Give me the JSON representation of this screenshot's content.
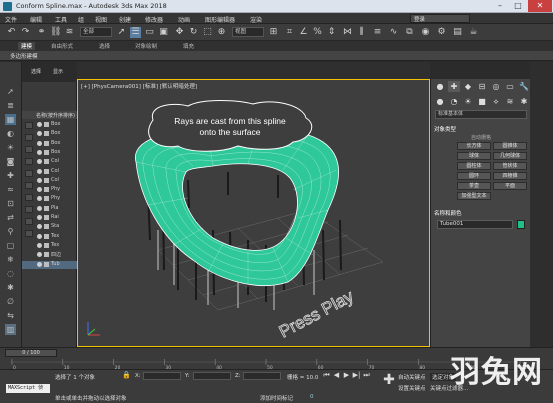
{
  "window": {
    "title": "Conform Spline.max - Autodesk 3ds Max 2018"
  },
  "menu": {
    "items": [
      "文件",
      "编辑",
      "工具",
      "组",
      "视图",
      "创建",
      "修改器",
      "动画",
      "图形编辑器",
      "渲染"
    ],
    "login": "登录"
  },
  "toolbar": {
    "filter": "全部",
    "view": "视图"
  },
  "ribbon": {
    "tabs": [
      "建模",
      "自由形式",
      "选择",
      "对象绘制",
      "填充"
    ],
    "sub": "多边形建模"
  },
  "explorer": {
    "tabs": [
      "选择",
      "显示"
    ],
    "header": "名称(按升序排序)",
    "rows": [
      "Box",
      "Box",
      "Box",
      "Box",
      "Col",
      "Col",
      "Col",
      "Phy",
      "Phy",
      "Pla",
      "Rai",
      "Sta",
      "Tex",
      "Tex",
      "四边",
      "Tub"
    ]
  },
  "viewport": {
    "label": "[+] [PhysCamera001] [标准] [默认明暗处理]",
    "annotation_line1": "Rays are cast from this spline",
    "annotation_line2": "onto the surface",
    "press_play": "Press Play"
  },
  "command_panel": {
    "dropdown": "标准基本体",
    "section_object_type": "对象类型",
    "auto_grid": "自动栅格",
    "buttons": [
      "长方体",
      "圆锥体",
      "球体",
      "几何球体",
      "圆柱体",
      "管状体",
      "圆环",
      "四棱锥",
      "茶壶",
      "平面",
      "加强型文本"
    ],
    "section_name_color": "名称和颜色",
    "object_name": "Tube001",
    "object_color": "#1fbf86"
  },
  "timeline": {
    "slider": "0 / 100",
    "ticks": [
      "0",
      "10",
      "20",
      "30",
      "40",
      "50",
      "60",
      "70",
      "80",
      "90",
      "100"
    ]
  },
  "status": {
    "selection": "选择了 1 个对象",
    "hint": "单击或单击并拖动以选择对象",
    "x_label": "X:",
    "y_label": "Y:",
    "z_label": "Z:",
    "grid": "栅格 = 10.0",
    "add_time_tag": "添加时间标记",
    "auto_key": "自动关键点",
    "set_key": "设置关键点",
    "selected_obj": "选定对象",
    "key_filter": "关键点过滤器...",
    "maxscript": "MAXScript 侦",
    "frame": "0"
  }
}
